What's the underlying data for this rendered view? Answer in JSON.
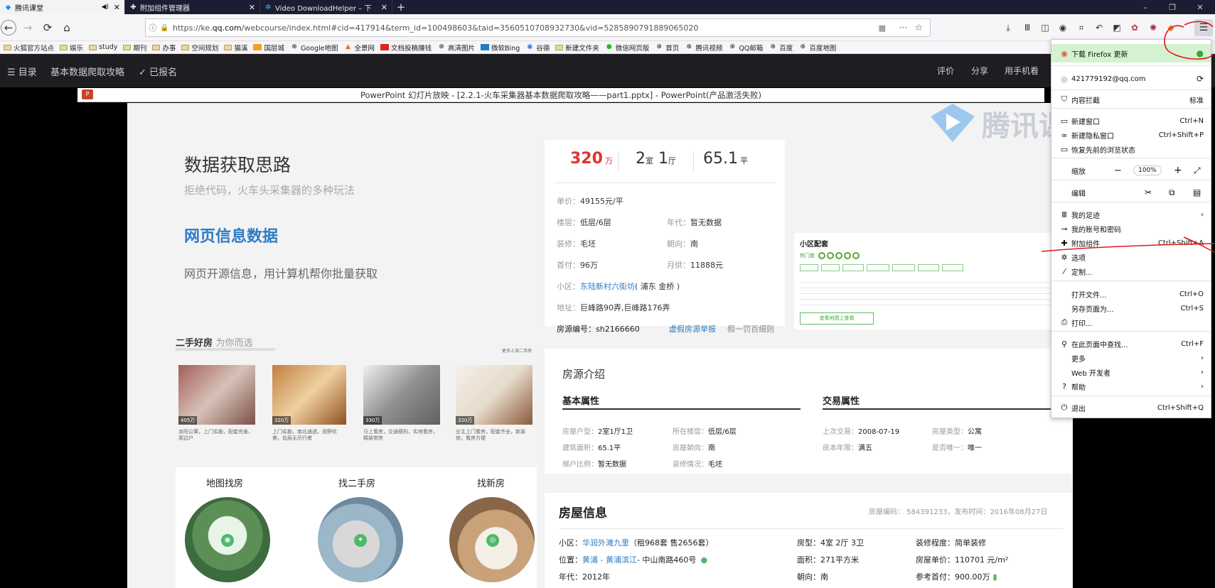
{
  "tabs": [
    {
      "label": "腾讯课堂",
      "icon": "tencent-classroom-icon",
      "audio": "◀)",
      "close": "✕"
    },
    {
      "label": "附加组件管理器",
      "icon": "puzzle-icon",
      "close": "✕"
    },
    {
      "label": "Video DownloadHelper – 下",
      "icon": "vdh-icon",
      "close": "✕"
    }
  ],
  "window": {
    "minimize": "–",
    "restore": "❐",
    "close": "✕",
    "newtab": "+"
  },
  "nav": {
    "url_prefix": "https://ke.",
    "url_domain": "qq.com",
    "url_path": "/webcourse/index.html#cid=417914&term_id=100498603&taid=3560510708932730&vid=5285890791889065020",
    "more": "···"
  },
  "bookmarks": [
    "火狐官方站点",
    "娱乐",
    "study",
    "期刊",
    "办事",
    "空间规划",
    "猫溪",
    "国层城",
    "Google地图",
    "全景网",
    "文档投稿赚钱",
    "高清图片",
    "微软Bing",
    "谷德",
    "新建文件夹",
    "微信网页版",
    "首页",
    "腾讯视频",
    "QQ邮箱",
    "百度",
    "百度地图"
  ],
  "course": {
    "menu_label": "☰ 目录",
    "course_title": "基本数据爬取攻略",
    "enrolled": "✓ 已报名",
    "rate": "评价",
    "share": "分享",
    "mobile": "用手机看"
  },
  "ppt_title": "PowerPoint 幻灯片放映 - [2.2.1-火车采集器基本数据爬取攻略——part1.pptx] - PowerPoint(产品激活失败)",
  "slide": {
    "title": "数据获取思路",
    "subtitle": "拒绝代码，火车头采集器的多种玩法",
    "heading": "网页信息数据",
    "desc": "网页开源信息，用计算机帮你批量获取",
    "watermark": "腾讯课"
  },
  "listing": {
    "price": "320",
    "price_unit": "万",
    "rooms": "2",
    "room_unit": "室",
    "halls": "1",
    "hall_unit": "厅",
    "area": "65.1",
    "area_unit": "平",
    "rows": [
      {
        "l1": "单价：",
        "v1": "49155元/平"
      },
      {
        "l1": "楼层：",
        "v1": "低层/6层",
        "l2": "年代：",
        "v2": "暂无数据"
      },
      {
        "l1": "装修：",
        "v1": "毛坯",
        "l2": "朝向：",
        "v2": "南"
      },
      {
        "l1": "首付：",
        "v1": "96万",
        "l2": "月供：",
        "v2": "11888元"
      }
    ],
    "community_label": "小区：",
    "community": "东陆新村六街坊",
    "community_loc": "( 浦东 金桥 )",
    "address_label": "地址：",
    "address": "巨峰路90弄,巨峰路176弄",
    "code_label": "房源编号：sh2166660",
    "report": "虚假房源举报",
    "fake": "假一罚百细则"
  },
  "community_card": {
    "title": "小区配套",
    "button": "查看地图上查看"
  },
  "secondhand": {
    "title": "二手好房",
    "title2": "为你而选",
    "more": "更多上海二手房",
    "items": [
      {
        "tag": "405万",
        "cap": "龙阳公寓，上门实勘，配套完善，周边户"
      },
      {
        "tag": "320万",
        "cap": "上门实勘，南北通透，视野优美，低层无尽行者"
      },
      {
        "tag": "330万",
        "cap": "马上看房，交通便利，实地看房，精装带房"
      },
      {
        "tag": "320万",
        "cap": "业主上门看房，配套齐全，新装修，看房方便"
      }
    ]
  },
  "finder": {
    "items": [
      "地图找房",
      "找二手房",
      "找新房"
    ]
  },
  "intro": {
    "title": "房源介绍",
    "basic": "基本属性",
    "trade": "交易属性",
    "basic_rows": [
      {
        "l": "房屋户型：",
        "v": "2室1厅1卫",
        "l2": "所在楼层：",
        "v2": "低层/6层"
      },
      {
        "l": "建筑面积：",
        "v": "65.1平",
        "l2": "房屋朝向：",
        "v2": "南"
      },
      {
        "l": "梯户比例：",
        "v": "暂无数据",
        "l2": "装修情况：",
        "v2": "毛坯"
      }
    ],
    "trade_rows": [
      {
        "l": "上次交易：",
        "v": "2008-07-19",
        "l2": "房屋类型：",
        "v2": "公寓"
      },
      {
        "l": "房本年限：",
        "v": "满五",
        "l2": "是否唯一：",
        "v2": "唯一"
      }
    ]
  },
  "house": {
    "title": "房屋信息",
    "code": "房屋编码： 584391233，发布时间：2016年08月27日",
    "c1": "小区：",
    "c1v": "华润外滩九里",
    "c1x": "（租968套 售2656套）",
    "c2": "位置：",
    "c2v": "黄浦 - 黄浦滨江",
    "c2x": "- 中山南路460号",
    "c3": "年代：2012年",
    "m1": "房型：4室 2厅 3卫",
    "m2": "面积：271平方米",
    "m3": "朝向：南",
    "r1": "装修程度：简单装修",
    "r2": "房屋单价：110701 元/m²",
    "r3": "参考首付：900.00万"
  },
  "menu": {
    "update": "下载 Firefox 更新",
    "account": "421779192@qq.com",
    "blocking": "内容拦截",
    "blocking_val": "标准",
    "new_window": "新建窗口",
    "new_window_sc": "Ctrl+N",
    "private": "新建隐私窗口",
    "private_sc": "Ctrl+Shift+P",
    "restore": "恢复先前的浏览状态",
    "zoom": "缩放",
    "zoom_val": "100%",
    "zoom_minus": "−",
    "zoom_plus": "+",
    "edit": "编辑",
    "library": "我的足迹",
    "logins": "我的账号和密码",
    "addons": "附加组件",
    "addons_sc": "Ctrl+Shift+A",
    "options": "选项",
    "customize": "定制...",
    "open_file": "打开文件...",
    "open_file_sc": "Ctrl+O",
    "save_as": "另存页面为...",
    "save_as_sc": "Ctrl+S",
    "print": "打印...",
    "find": "在此页面中查找...",
    "find_sc": "Ctrl+F",
    "more": "更多",
    "webdev": "Web 开发者",
    "help": "帮助",
    "quit": "退出",
    "quit_sc": "Ctrl+Shift+Q"
  }
}
